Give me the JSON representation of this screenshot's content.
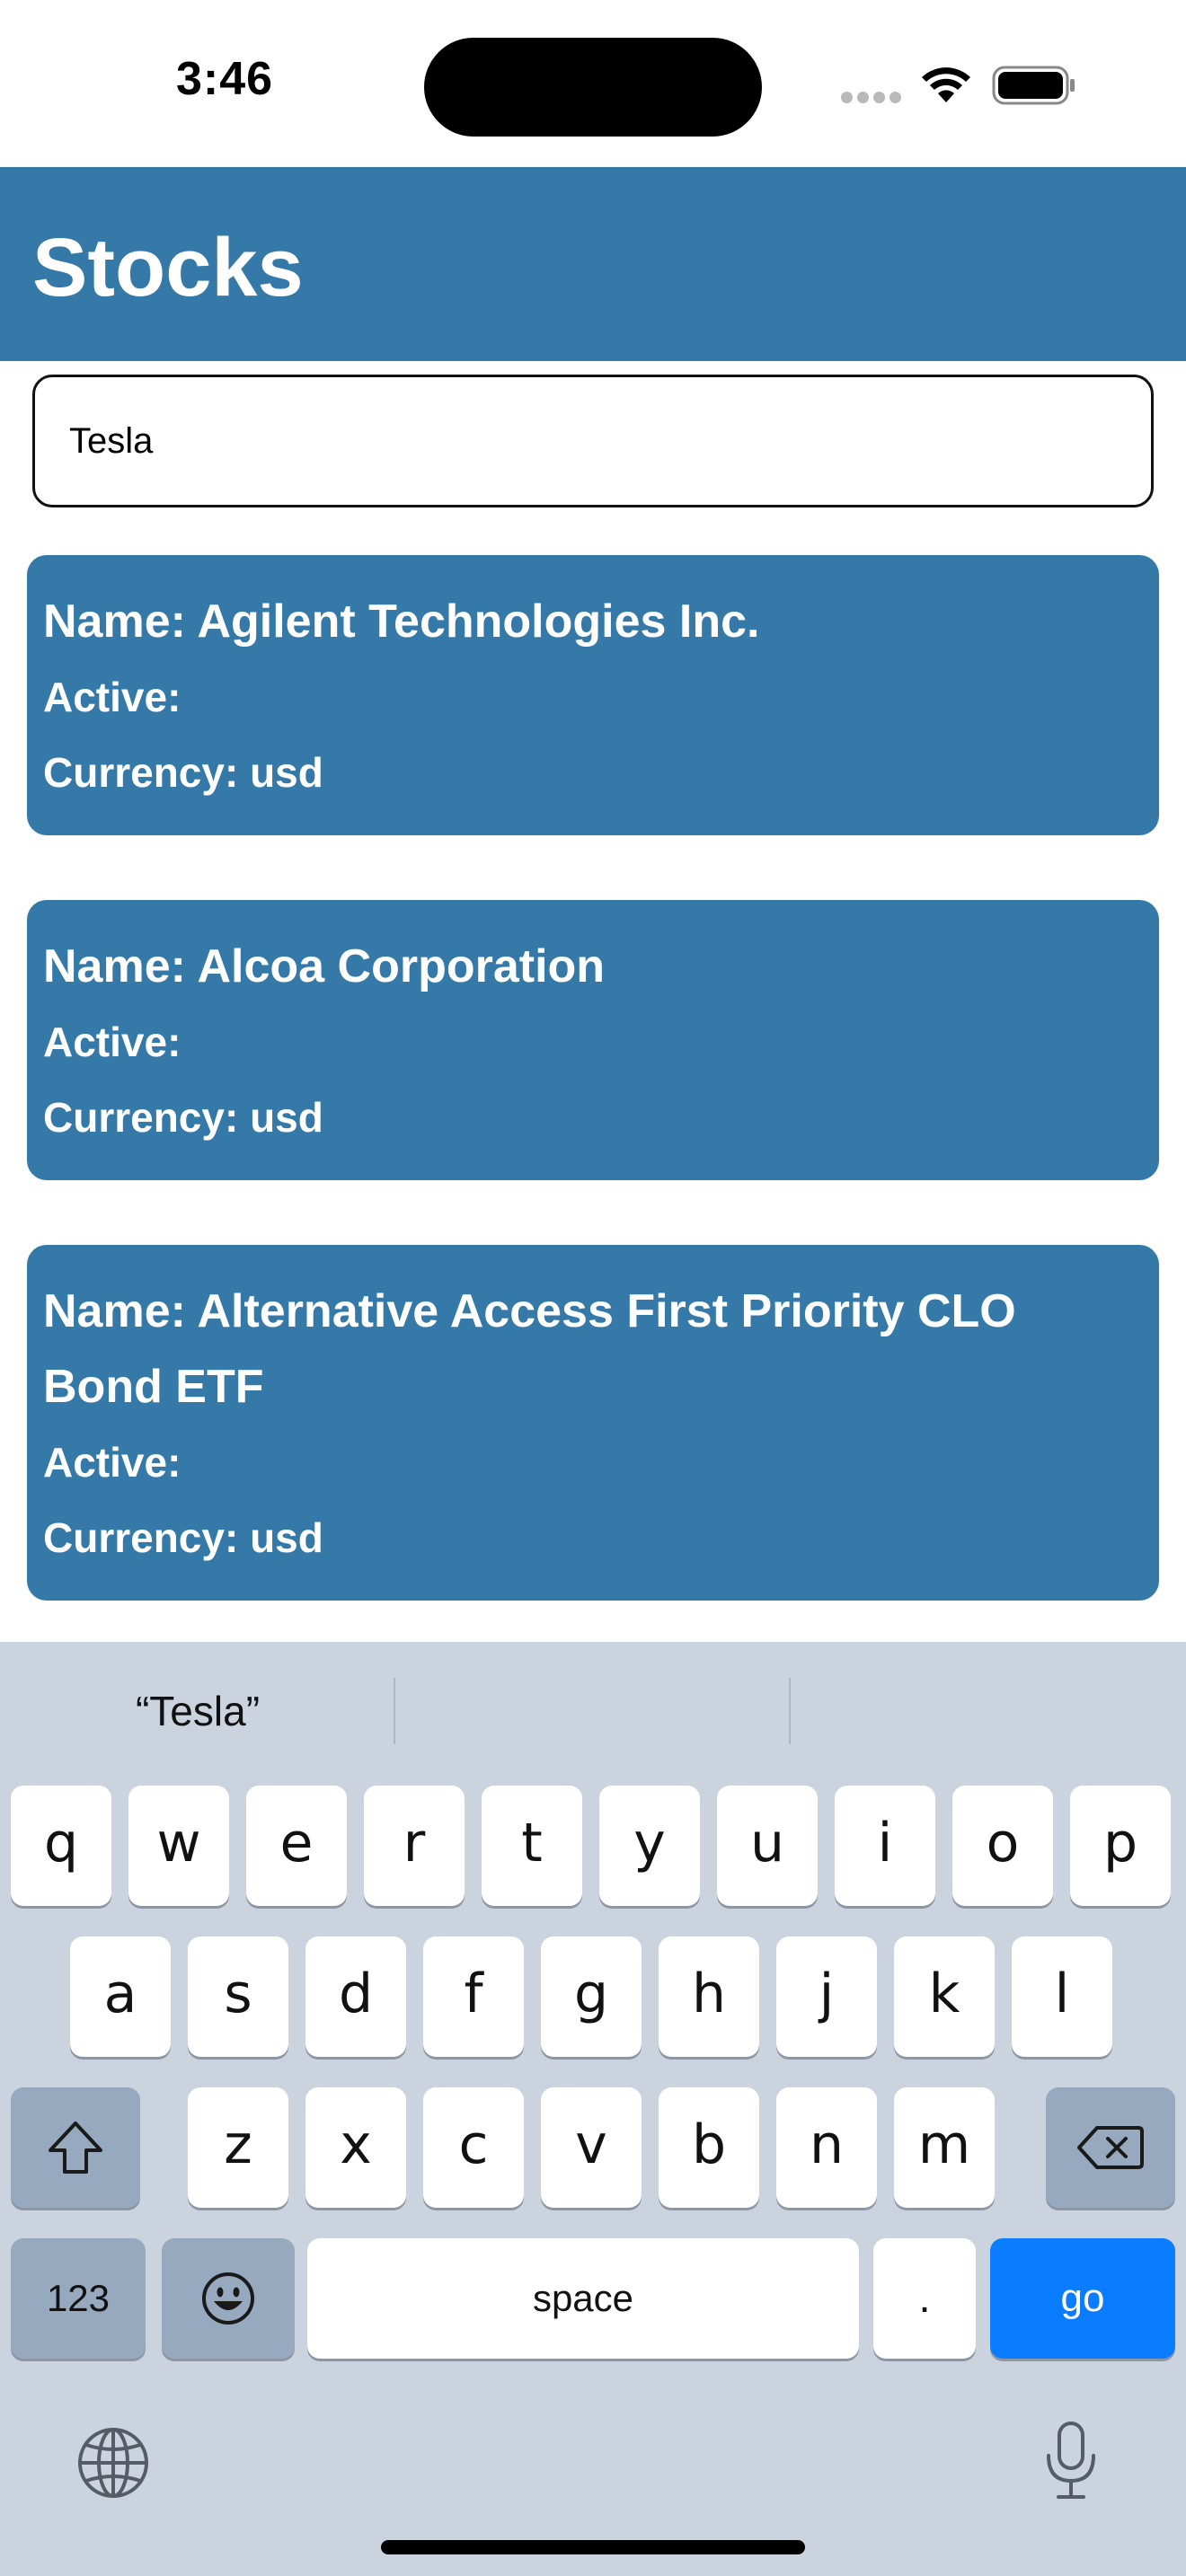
{
  "status_bar": {
    "time": "3:46"
  },
  "header": {
    "title": "Stocks",
    "color": "#3579a8"
  },
  "search": {
    "value": "Tesla"
  },
  "stocks": [
    {
      "name": "Name: Agilent Technologies Inc.",
      "active": "Active:",
      "currency": "Currency: usd"
    },
    {
      "name": "Name: Alcoa Corporation",
      "active": "Active:",
      "currency": "Currency: usd"
    },
    {
      "name": "Name: Alternative Access First Priority CLO Bond ETF",
      "active": "Active:",
      "currency": "Currency: usd"
    }
  ],
  "keyboard": {
    "suggestions": [
      "“Tesla”",
      "",
      ""
    ],
    "row1": [
      "q",
      "w",
      "e",
      "r",
      "t",
      "y",
      "u",
      "i",
      "o",
      "p"
    ],
    "row2": [
      "a",
      "s",
      "d",
      "f",
      "g",
      "h",
      "j",
      "k",
      "l"
    ],
    "row3": [
      "z",
      "x",
      "c",
      "v",
      "b",
      "n",
      "m"
    ],
    "numbers_key": "123",
    "space_key": "space",
    "period_key": ".",
    "go_key": "go",
    "icons": [
      "shift-icon",
      "backspace-icon",
      "emoji-icon",
      "globe-icon",
      "microphone-icon"
    ],
    "accent_color": "#0a7cff"
  }
}
